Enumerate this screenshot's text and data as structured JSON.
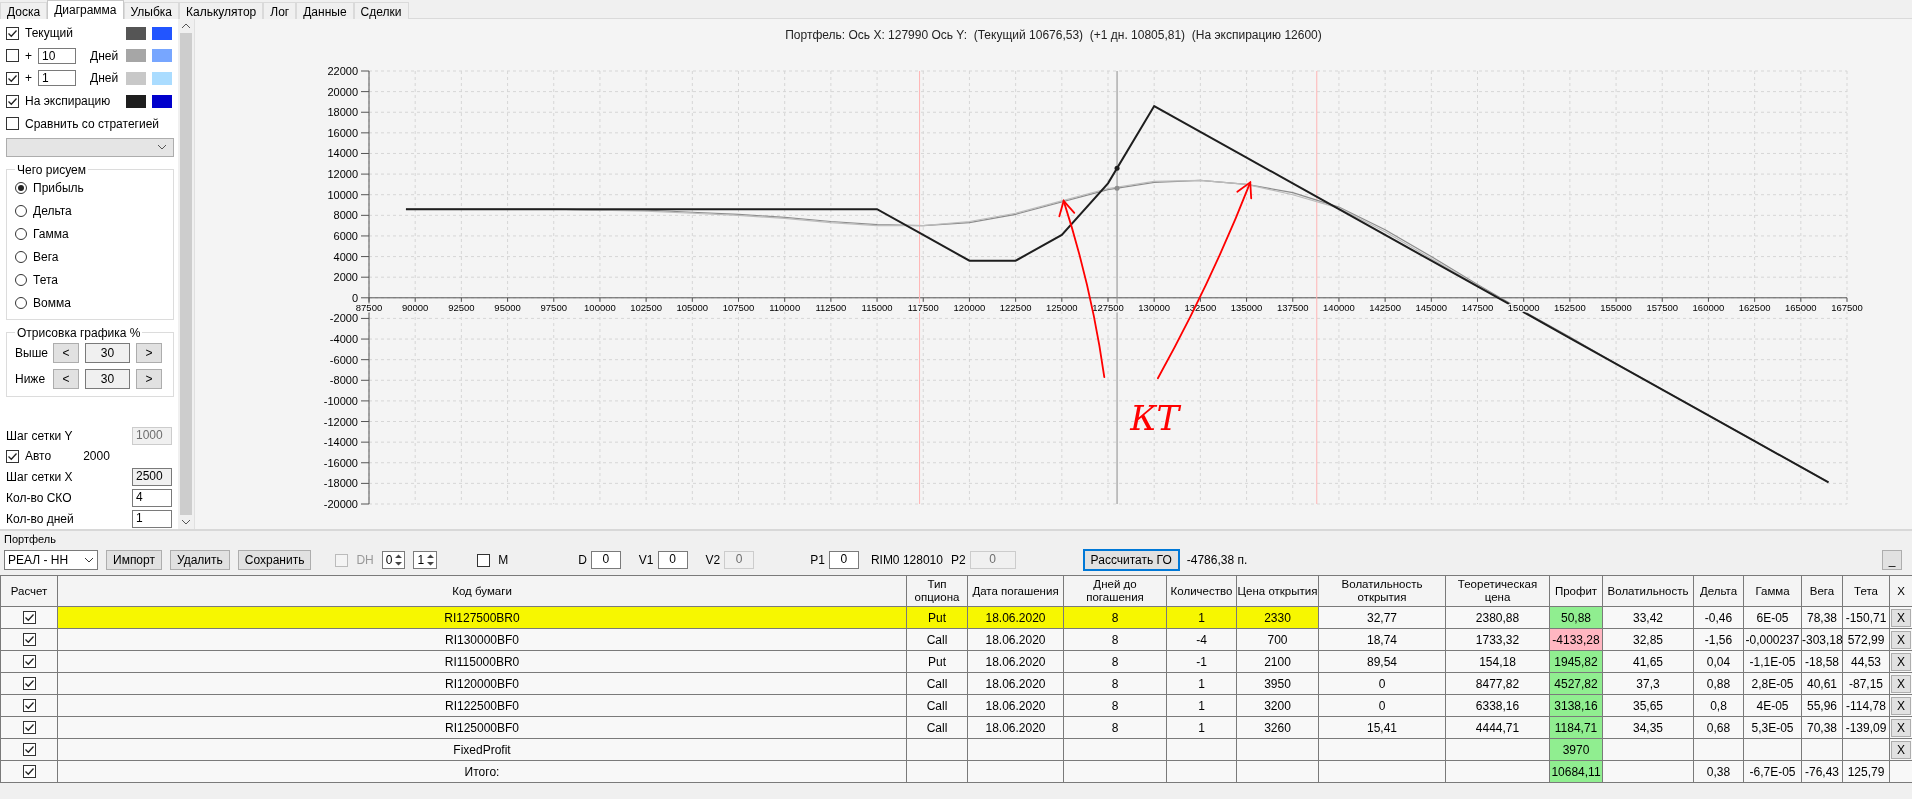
{
  "tabs": [
    {
      "label": "Доска",
      "selected": false
    },
    {
      "label": "Диаграмма",
      "selected": true
    },
    {
      "label": "Улыбка",
      "selected": false
    },
    {
      "label": "Калькулятор",
      "selected": false
    },
    {
      "label": "Лог",
      "selected": false
    },
    {
      "label": "Данные",
      "selected": false
    },
    {
      "label": "Сделки",
      "selected": false
    }
  ],
  "sidebar": {
    "curves": [
      {
        "kind": "plain",
        "label": "Текущий",
        "checked": true,
        "swatches": [
          {
            "color": "#555555"
          },
          {
            "color": "#2255ff"
          }
        ]
      },
      {
        "kind": "days",
        "prefix": "+",
        "days": "10",
        "unit": "Дней",
        "checked": false,
        "swatches": [
          {
            "color": "#a6a6a6"
          },
          {
            "color": "#77a6ff"
          }
        ]
      },
      {
        "kind": "days",
        "prefix": "+",
        "days": "1",
        "unit": "Дней",
        "checked": true,
        "swatches": [
          {
            "color": "#c8c8c8"
          },
          {
            "color": "#aadcff"
          }
        ]
      },
      {
        "kind": "plain",
        "label": "На экспирацию",
        "checked": true,
        "swatches": [
          {
            "color": "#1e1e1e"
          },
          {
            "color": "#0000cc"
          }
        ]
      }
    ],
    "compare": {
      "label": "Сравнить со стратегией",
      "checked": false
    },
    "plot_group": {
      "title": "Чего рисуем",
      "options": [
        {
          "label": "Прибыль",
          "selected": true
        },
        {
          "label": "Дельта",
          "selected": false
        },
        {
          "label": "Гамма",
          "selected": false
        },
        {
          "label": "Вега",
          "selected": false
        },
        {
          "label": "Тета",
          "selected": false
        },
        {
          "label": "Вомма",
          "selected": false
        }
      ]
    },
    "range_group": {
      "title": "Отрисовка графика %",
      "rows": [
        {
          "label": "Выше",
          "dec": "<",
          "value": "30",
          "inc": ">"
        },
        {
          "label": "Ниже",
          "dec": "<",
          "value": "30",
          "inc": ">"
        }
      ]
    },
    "settings": [
      {
        "kind": "field",
        "label": "Шаг сетки Y",
        "value": "1000",
        "disabled": true,
        "readonly": false
      },
      {
        "kind": "checkbox",
        "label": "Авто",
        "checked": true,
        "value": "2000"
      },
      {
        "kind": "field",
        "label": "Шаг сетки X",
        "value": "2500",
        "disabled": false,
        "readonly": true
      },
      {
        "kind": "field",
        "label": "Кол-во СКО",
        "value": "4",
        "disabled": false,
        "readonly": false
      },
      {
        "kind": "field",
        "label": "Кол-во дней",
        "value": "1",
        "disabled": false,
        "readonly": false
      }
    ]
  },
  "chart": {
    "title": "Портфель: Ось X: 127990 Ось Y:  (Текущий 10676,53)  (+1 дн. 10805,81)  (На экспирацию 12600)",
    "chart_data": {
      "type": "line",
      "grid": true,
      "x": [
        89500,
        90000,
        92500,
        95000,
        97500,
        100000,
        102500,
        105000,
        107500,
        110000,
        112500,
        115000,
        117500,
        120000,
        122500,
        125000,
        127500,
        130000,
        132500,
        135000,
        137500,
        140000,
        142500,
        145000,
        147500,
        150000,
        152500,
        155000,
        157500,
        160000,
        162500,
        165000,
        166500
      ],
      "series": [
        {
          "color": "#8c8c8c",
          "values": [
            8600,
            8600,
            8600,
            8600,
            8600,
            8500,
            8500,
            8300,
            8100,
            7800,
            7400,
            7100,
            7000,
            7300,
            8100,
            9300,
            10500,
            11200,
            11400,
            11000,
            10200,
            8800,
            6600,
            4000,
            1300,
            -1300,
            -3800,
            -6400,
            -8900,
            -11400,
            -13900,
            -16400,
            -17900
          ]
        },
        {
          "color": "#bcbcbc",
          "values": [
            8600,
            8600,
            8600,
            8600,
            8600,
            8500,
            8400,
            8200,
            8000,
            7700,
            7300,
            7000,
            7000,
            7400,
            8200,
            9400,
            10600,
            11300,
            11400,
            11000,
            10000,
            8700,
            6400,
            3800,
            1200,
            -1400,
            -3900,
            -6400,
            -8900,
            -11400,
            -13900,
            -16400,
            -17900
          ]
        },
        {
          "color": "#1e1e1e",
          "values": [
            8600,
            8600,
            8600,
            8600,
            8600,
            8600,
            8600,
            8600,
            8600,
            8600,
            8600,
            8600,
            6100,
            3600,
            3600,
            6100,
            11100,
            18600,
            16100,
            13600,
            11100,
            8600,
            6100,
            3600,
            1100,
            -1400,
            -3900,
            -6400,
            -8900,
            -11400,
            -13900,
            -16400,
            -17900
          ]
        }
      ],
      "xlim": [
        87500,
        167500
      ],
      "ylim": [
        -20000,
        22000
      ],
      "xticks": [
        87500,
        90000,
        92500,
        95000,
        97500,
        100000,
        102500,
        105000,
        107500,
        110000,
        112500,
        115000,
        117500,
        120000,
        122500,
        125000,
        127500,
        130000,
        132500,
        135000,
        137500,
        140000,
        142500,
        145000,
        147500,
        150000,
        152500,
        155000,
        157500,
        160000,
        162500,
        165000,
        167500
      ],
      "yticks": [
        -20000,
        -18000,
        -16000,
        -14000,
        -12000,
        -10000,
        -8000,
        -6000,
        -4000,
        -2000,
        0,
        2000,
        4000,
        6000,
        8000,
        10000,
        12000,
        14000,
        16000,
        18000,
        20000,
        22000
      ],
      "ref_lines": [
        {
          "axis": "x",
          "value": 117300,
          "color": "#ffb4b4"
        },
        {
          "axis": "x",
          "value": 138800,
          "color": "#ffb4b4"
        },
        {
          "axis": "x",
          "value": 127990,
          "color": "#8c8c8c"
        }
      ],
      "annotations": [
        "КТ"
      ]
    }
  },
  "portfolio": {
    "title": "Портфель",
    "account": "РЕАЛ - НН",
    "buttons": [
      "Импорт",
      "Удалить",
      "Сохранить"
    ],
    "dh": {
      "label": "DH",
      "checked": false,
      "disabled": true
    },
    "spinners": [
      "0",
      "1"
    ],
    "m": {
      "label": "M",
      "checked": false
    },
    "params": [
      {
        "label": "D",
        "value": "0",
        "disabled": false
      },
      {
        "label": "V1",
        "value": "0",
        "disabled": false
      },
      {
        "label": "V2",
        "value": "0",
        "disabled": true
      },
      {
        "label": "P1",
        "value": "0",
        "disabled": false
      }
    ],
    "instrument": "RIM0 128010",
    "p2": {
      "label": "P2",
      "value": "0",
      "disabled": true
    },
    "calc_button": "Рассчитать ГО",
    "margin": "-4786,38 п.",
    "minimize": "_"
  },
  "table": {
    "columns": [
      {
        "kind": "check",
        "label": "Расчет"
      },
      {
        "kind": "text",
        "label": "Код бумаги"
      },
      {
        "kind": "text",
        "label": "Тип опциона"
      },
      {
        "kind": "text",
        "label": "Дата погашения"
      },
      {
        "kind": "text",
        "label": "Дней до погашения"
      },
      {
        "kind": "text",
        "label": "Количество"
      },
      {
        "kind": "text",
        "label": "Цена открытия"
      },
      {
        "kind": "text",
        "label": "Волатильность открытия"
      },
      {
        "kind": "text",
        "label": "Теоретическая цена"
      },
      {
        "kind": "profit",
        "label": "Профит"
      },
      {
        "kind": "text",
        "label": "Волатильность"
      },
      {
        "kind": "text",
        "label": "Дельта"
      },
      {
        "kind": "text",
        "label": "Гамма"
      },
      {
        "kind": "text",
        "label": "Вега"
      },
      {
        "kind": "text",
        "label": "Тета"
      },
      {
        "kind": "remove",
        "label": "X"
      }
    ],
    "rows": [
      {
        "checked": true,
        "highlighted": true,
        "color": "#90ee90",
        "cells": [
          "",
          "RI127500BR0",
          "Put",
          "18.06.2020",
          "8",
          "1",
          "2330",
          "32,77",
          "2380,88",
          "50,88",
          "33,42",
          "-0,46",
          "6E-05",
          "78,38",
          "-150,71",
          "X"
        ]
      },
      {
        "checked": true,
        "highlighted": false,
        "color": "#ffb6c1",
        "cells": [
          "",
          "RI130000BF0",
          "Call",
          "18.06.2020",
          "8",
          "-4",
          "700",
          "18,74",
          "1733,32",
          "-4133,28",
          "32,85",
          "-1,56",
          "-0,000237",
          "-303,18",
          "572,99",
          "X"
        ]
      },
      {
        "checked": true,
        "highlighted": false,
        "color": "#90ee90",
        "cells": [
          "",
          "RI115000BR0",
          "Put",
          "18.06.2020",
          "8",
          "-1",
          "2100",
          "89,54",
          "154,18",
          "1945,82",
          "41,65",
          "0,04",
          "-1,1E-05",
          "-18,58",
          "44,53",
          "X"
        ]
      },
      {
        "checked": true,
        "highlighted": false,
        "color": "#90ee90",
        "cells": [
          "",
          "RI120000BF0",
          "Call",
          "18.06.2020",
          "8",
          "1",
          "3950",
          "0",
          "8477,82",
          "4527,82",
          "37,3",
          "0,88",
          "2,8E-05",
          "40,61",
          "-87,15",
          "X"
        ]
      },
      {
        "checked": true,
        "highlighted": false,
        "color": "#90ee90",
        "cells": [
          "",
          "RI122500BF0",
          "Call",
          "18.06.2020",
          "8",
          "1",
          "3200",
          "0",
          "6338,16",
          "3138,16",
          "35,65",
          "0,8",
          "4E-05",
          "55,96",
          "-114,78",
          "X"
        ]
      },
      {
        "checked": true,
        "highlighted": false,
        "color": "#90ee90",
        "cells": [
          "",
          "RI125000BF0",
          "Call",
          "18.06.2020",
          "8",
          "1",
          "3260",
          "15,41",
          "4444,71",
          "1184,71",
          "34,35",
          "0,68",
          "5,3E-05",
          "70,38",
          "-139,09",
          "X"
        ]
      },
      {
        "checked": true,
        "highlighted": false,
        "color": "#90ee90",
        "cells": [
          "",
          "FixedProfit",
          "",
          "",
          "",
          "",
          "",
          "",
          "",
          "3970",
          "",
          "",
          "",
          "",
          "",
          "X"
        ]
      },
      {
        "checked": true,
        "highlighted": false,
        "color": "#90ee90",
        "cells": [
          "",
          "Итого:",
          "",
          "",
          "",
          "",
          "",
          "",
          "",
          "10684,11",
          "",
          "0,38",
          "-6,7E-05",
          "-76,43",
          "125,79",
          ""
        ]
      }
    ]
  }
}
